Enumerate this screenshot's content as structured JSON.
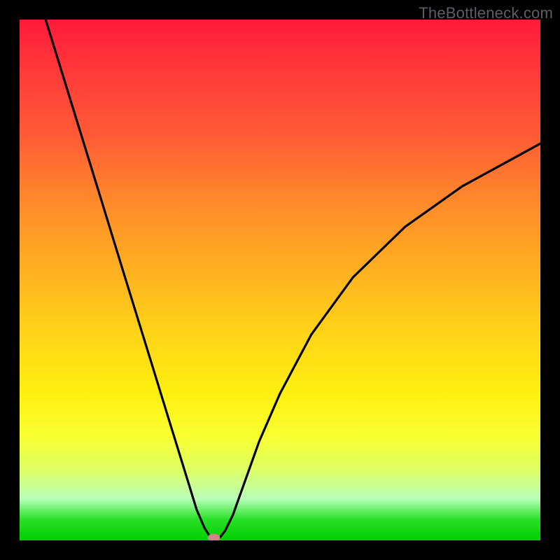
{
  "watermark": "TheBottleneck.com",
  "chart_data": {
    "type": "line",
    "title": "",
    "xlabel": "",
    "ylabel": "",
    "xlim": [
      0,
      1
    ],
    "ylim": [
      0,
      1
    ],
    "annotations": [],
    "series": [
      {
        "name": "bottleneck-curve",
        "x": [
          0.05,
          0.1,
          0.15,
          0.2,
          0.25,
          0.29,
          0.32,
          0.34,
          0.355,
          0.365,
          0.375,
          0.385,
          0.395,
          0.41,
          0.43,
          0.46,
          0.5,
          0.56,
          0.64,
          0.74,
          0.85,
          1.0
        ],
        "values": [
          1.0,
          0.838,
          0.676,
          0.513,
          0.351,
          0.221,
          0.124,
          0.059,
          0.024,
          0.008,
          0.0,
          0.006,
          0.019,
          0.05,
          0.106,
          0.19,
          0.282,
          0.395,
          0.505,
          0.602,
          0.68,
          0.762
        ]
      }
    ],
    "marker": {
      "x": 0.373,
      "y": 0.005,
      "rx": 0.012,
      "ry": 0.008,
      "color": "#cf8686"
    },
    "background_gradient_stops": [
      {
        "pos": 0.0,
        "color": "#ff1a3a"
      },
      {
        "pos": 0.35,
        "color": "#ff8a2a"
      },
      {
        "pos": 0.6,
        "color": "#ffd318"
      },
      {
        "pos": 0.8,
        "color": "#f8ff30"
      },
      {
        "pos": 0.92,
        "color": "#b8ffb8"
      },
      {
        "pos": 1.0,
        "color": "#00d000"
      }
    ]
  }
}
